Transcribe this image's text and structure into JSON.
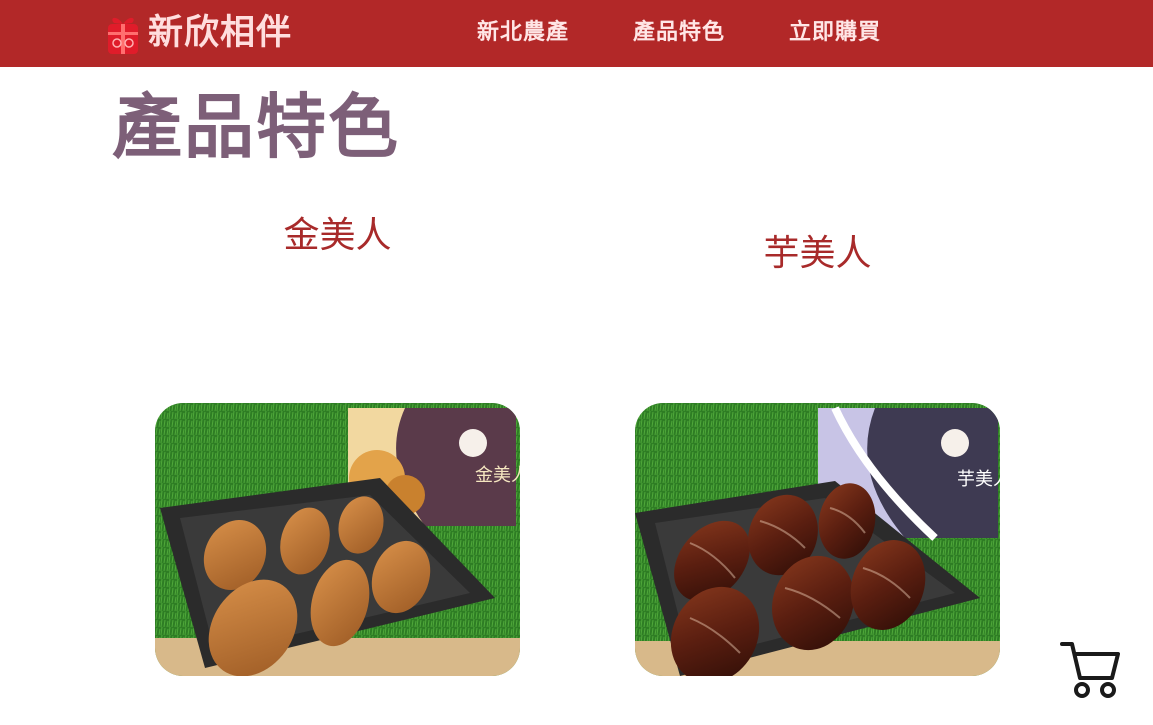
{
  "header": {
    "brand_name": "新欣相伴",
    "logo_icon": "gift-box-icon",
    "nav": [
      {
        "label": "新北農產"
      },
      {
        "label": "產品特色"
      },
      {
        "label": "立即購買"
      }
    ],
    "background_color": "#b22828"
  },
  "main": {
    "section_title": "產品特色",
    "products": [
      {
        "name": "金美人",
        "image": "golden sweet potato pastries in gift box",
        "box_label": "金美人"
      },
      {
        "name": "芋美人",
        "image": "glazed taro pastries in gift box",
        "box_label": "芋美人"
      }
    ]
  },
  "floating": {
    "cart_icon": "shopping-cart-icon"
  },
  "colors": {
    "title": "#7d5f78",
    "product_name": "#a82a2a",
    "nav_text": "#ffe6e6"
  }
}
